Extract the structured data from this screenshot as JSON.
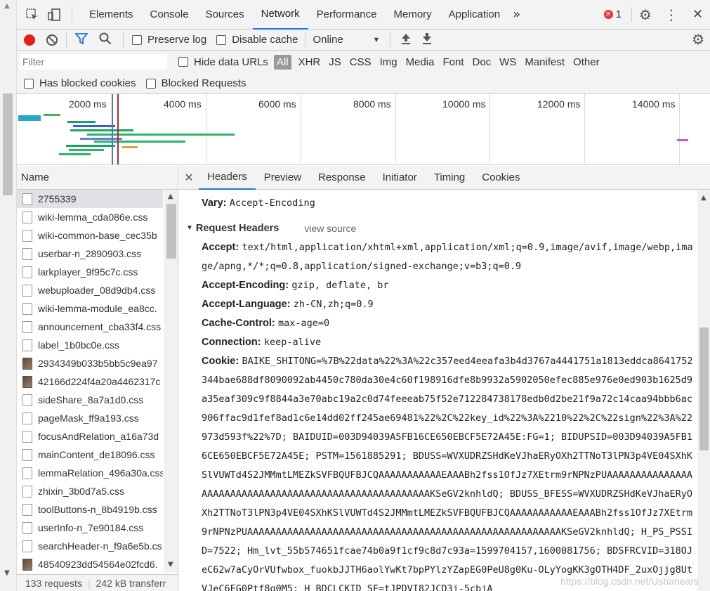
{
  "tabs": [
    "Elements",
    "Console",
    "Sources",
    "Network",
    "Performance",
    "Memory",
    "Application"
  ],
  "active_tab": "Network",
  "error_count": "1",
  "toolbar": {
    "preserve_log": "Preserve log",
    "disable_cache": "Disable cache",
    "throttle": "Online"
  },
  "filter": {
    "placeholder": "Filter",
    "hide_data_urls": "Hide data URLs",
    "types": [
      "All",
      "XHR",
      "JS",
      "CSS",
      "Img",
      "Media",
      "Font",
      "Doc",
      "WS",
      "Manifest",
      "Other"
    ],
    "has_blocked_cookies": "Has blocked cookies",
    "blocked_requests": "Blocked Requests"
  },
  "overview": {
    "ticks": [
      "2000 ms",
      "4000 ms",
      "6000 ms",
      "8000 ms",
      "10000 ms",
      "12000 ms",
      "14000 ms"
    ]
  },
  "requests": {
    "header": "Name",
    "items": [
      {
        "name": "2755339",
        "type": "doc"
      },
      {
        "name": "wiki-lemma_cda086e.css",
        "type": "doc"
      },
      {
        "name": "wiki-common-base_cec35b",
        "type": "doc"
      },
      {
        "name": "userbar-n_2890903.css",
        "type": "doc"
      },
      {
        "name": "larkplayer_9f95c7c.css",
        "type": "doc"
      },
      {
        "name": "webuploader_08d9db4.css",
        "type": "doc"
      },
      {
        "name": "wiki-lemma-module_ea8cc.",
        "type": "doc"
      },
      {
        "name": "announcement_cba33f4.css",
        "type": "doc"
      },
      {
        "name": "label_1b0bc0e.css",
        "type": "doc"
      },
      {
        "name": "2934349b033b5bb5c9ea97",
        "type": "img"
      },
      {
        "name": "42166d224f4a20a4462317c",
        "type": "img"
      },
      {
        "name": "sideShare_8a7a1d0.css",
        "type": "doc"
      },
      {
        "name": "pageMask_ff9a193.css",
        "type": "doc"
      },
      {
        "name": "focusAndRelation_a16a73d",
        "type": "doc"
      },
      {
        "name": "mainContent_de18096.css",
        "type": "doc"
      },
      {
        "name": "lemmaRelation_496a30a.css",
        "type": "doc"
      },
      {
        "name": "zhixin_3b0d7a5.css",
        "type": "doc"
      },
      {
        "name": "toolButtons-n_8b4919b.css",
        "type": "doc"
      },
      {
        "name": "userInfo-n_7e90184.css",
        "type": "doc"
      },
      {
        "name": "searchHeader-n_f9a6e5b.cs",
        "type": "doc"
      },
      {
        "name": "48540923dd54564e02fcd6.",
        "type": "img"
      }
    ],
    "status_count": "133 requests",
    "status_transfer": "242 kB transferr"
  },
  "detail": {
    "tabs": [
      "Headers",
      "Preview",
      "Response",
      "Initiator",
      "Timing",
      "Cookies"
    ],
    "active": "Headers",
    "vary_key": "Vary:",
    "vary_val": "Accept-Encoding",
    "section_title": "Request Headers",
    "view_source": "view source",
    "headers": [
      {
        "k": "Accept:",
        "v": "text/html,application/xhtml+xml,application/xml;q=0.9,image/avif,image/webp,image/apng,*/*;q=0.8,application/signed-exchange;v=b3;q=0.9"
      },
      {
        "k": "Accept-Encoding:",
        "v": "gzip, deflate, br"
      },
      {
        "k": "Accept-Language:",
        "v": "zh-CN,zh;q=0.9"
      },
      {
        "k": "Cache-Control:",
        "v": "max-age=0"
      },
      {
        "k": "Connection:",
        "v": "keep-alive"
      },
      {
        "k": "Cookie:",
        "v": "BAIKE_SHITONG=%7B%22data%22%3A%22c357eed4eeafa3b4d3767a4441751a1813eddca8641752344bae688df8090092ab4450c780da30e4c60f198916dfe8b9932a5902050efec885e976e0ed903b1625d9a35eaf309c9f8844a3e70abc19a2c0d74feeeab75f52e712284738178edb0d2be21f9a72c14caa94bbb6ac906ffac9d1fef8ad1c6e14dd02ff245ae69481%22%2C%22key_id%22%3A%2210%22%2C%22sign%22%3A%22973d593f%22%7D; BAIDUID=003D94039A5FB16CE650EBCF5E72A45E:FG=1; BIDUPSID=003D94039A5FB16CE650EBCF5E72A45E; PSTM=1561885291; BDUSS=WVXUDRZSHdKeVJhaERyOXh2TTNoT3lPN3p4VE04SXhKSlVUWTd4S2JMMmtLMEZkSVFBQUFBJCQAAAAAAAAAAAEAAABh2fss1OfJz7XEtrm9rNPNzPUAAAAAAAAAAAAAAAAAAAAAAAAAAAAAAAAAAAAAAAAAAAAAAAAAAAAAAAKSeGV2knhldQ; BDUSS_BFESS=WVXUDRZSHdKeVJhaERyOXh2TTNoT3lPN3p4VE04SXhKSlVUWTd4S2JMMmtLMEZkSVFBQUFBJCQAAAAAAAAAAAEAAABh2fss1OfJz7XEtrm9rNPNzPUAAAAAAAAAAAAAAAAAAAAAAAAAAAAAAAAAAAAAAAAAAAAAAAAAAAAAAAKSeGV2knhldQ; H_PS_PSSID=7522; Hm_lvt_55b574651fcae74b0a9f1cf9c8d7c93a=1599704157,1600081756; BDSFRCVID=318OJeC62w7aCyOrVUfwbox_fuokbJJTH6aolYwKt7bpPYlzYZapEG0PeU8g0Ku-OLyYogKK3gOTH4DF_2uxOjjg8UtVJeC6EG0Ptf8g0M5; H_BDCLCKID_SF=tJPDVI82JCD3j-5cbjA"
      }
    ]
  },
  "watermark": "https://blog.csdn.net/Ushanears"
}
